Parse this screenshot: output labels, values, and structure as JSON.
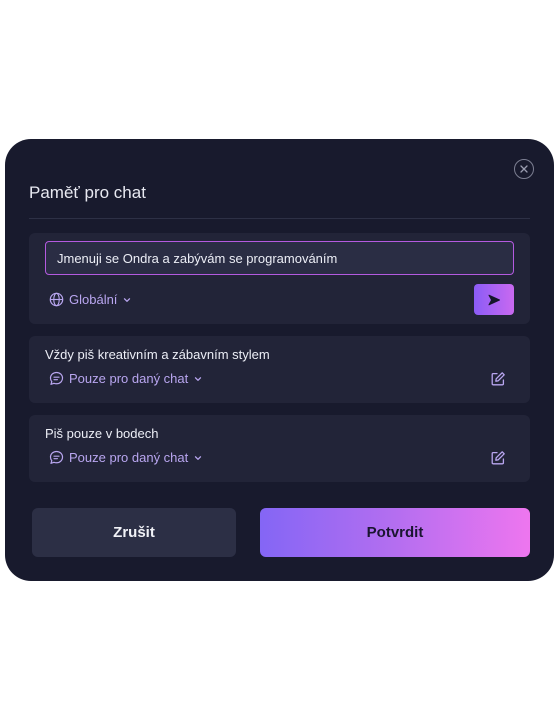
{
  "dialog": {
    "title": "Paměť pro chat",
    "input": {
      "value": "Jmenuji se Ondra a zabývám se programováním",
      "scope_label": "Globální",
      "scope_icon": "globe-icon",
      "send_icon": "send-arrow-icon"
    },
    "memories": [
      {
        "text": "Vždy piš kreativním a zábavním stylem",
        "scope_label": "Pouze pro daný chat",
        "scope_icon": "chat-bubble-icon",
        "action_icon": "edit-icon"
      },
      {
        "text": "Piš pouze v bodech",
        "scope_label": "Pouze pro daný chat",
        "scope_icon": "chat-bubble-icon",
        "action_icon": "edit-icon"
      }
    ],
    "buttons": {
      "cancel": "Zrušit",
      "confirm": "Potvrdit"
    },
    "close_icon": "close-icon"
  },
  "colors": {
    "modal_bg": "#181a2d",
    "card_bg": "#222438",
    "accent_purple": "#b9a6f0",
    "input_border": "#b45ae0",
    "confirm_gradient": [
      "#8466f5",
      "#ee76ef"
    ]
  }
}
